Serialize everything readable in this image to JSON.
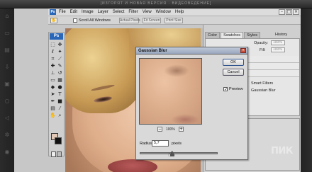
{
  "player": {
    "title": "[ИЗГОРЯТ И НОВАЯ ВЕРСИЯ · ВИДЕОВЕДЕНИЕ]",
    "side_icons": [
      "home-icon",
      "screen-icon",
      "film-icon",
      "download-icon",
      "lock-icon",
      "search-icon",
      "share-icon",
      "settings-icon",
      "user-icon"
    ]
  },
  "app": {
    "logo": "Ps",
    "menus": [
      "File",
      "Edit",
      "Image",
      "Layer",
      "Select",
      "Filter",
      "View",
      "Window",
      "Help"
    ],
    "window_buttons": [
      "–",
      "□",
      "×"
    ]
  },
  "options_bar": {
    "scroll_all_windows": "Scroll All Windows",
    "buttons": [
      "Actual Pixels",
      "Fit Screen",
      "Print Size"
    ]
  },
  "dialog": {
    "title": "Gaussian Blur",
    "ok": "OK",
    "cancel": "Cancel",
    "preview_label": "Preview",
    "preview_checked": true,
    "zoom_out": "−",
    "zoom_in": "+",
    "zoom_level": "100%",
    "radius_label": "Radius:",
    "radius_value": "5,7",
    "radius_unit": "pixels",
    "close": "×"
  },
  "panel": {
    "tabs": [
      "Color",
      "Swatches",
      "Styles"
    ],
    "active_tab": "Swatches",
    "history_tab": "History",
    "opacity_label": "Opacity:",
    "opacity_value": "100%",
    "fill_label": "Fill:",
    "fill_value": "100%",
    "layers": [
      "Smart Filters",
      "Gaussian Blur"
    ]
  },
  "watermark": "ПИК"
}
